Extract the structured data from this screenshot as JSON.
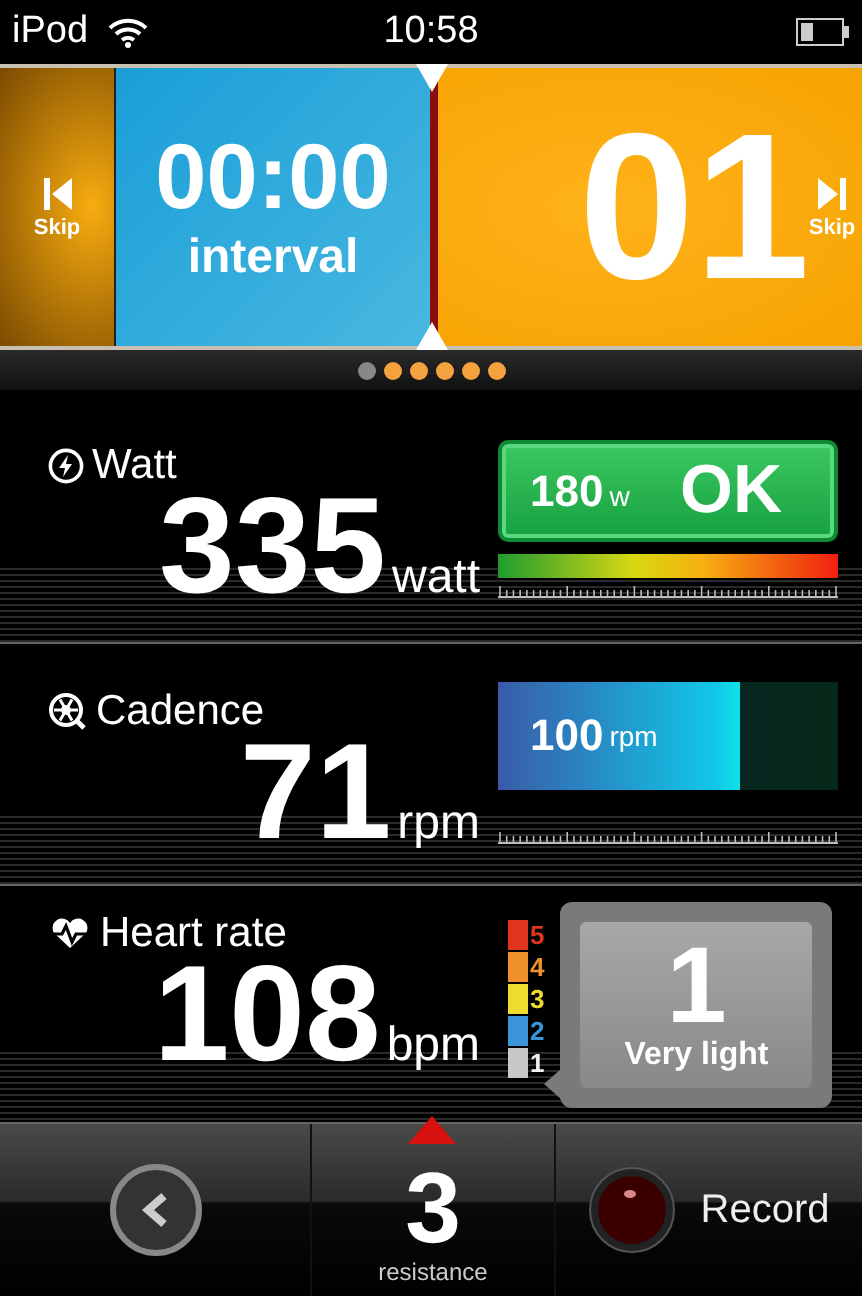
{
  "status_bar": {
    "carrier": "iPod",
    "time": "10:58"
  },
  "interval": {
    "prev_label": "Skip",
    "time": "00:00",
    "caption": "interval",
    "next_value": "01",
    "next_label": "Skip"
  },
  "page_dots": [
    {
      "selected": true
    },
    {
      "selected": false
    },
    {
      "selected": false
    },
    {
      "selected": false
    },
    {
      "selected": false
    },
    {
      "selected": false
    }
  ],
  "metrics": [
    {
      "kind": "target",
      "label": "Watt",
      "value": "335",
      "unit": "watt",
      "target": "180",
      "target_unit": "w",
      "status": "OK"
    },
    {
      "kind": "bar",
      "label": "Cadence",
      "value": "71",
      "unit": "rpm",
      "target": "100",
      "target_unit": "rpm",
      "level": 0.71
    },
    {
      "kind": "zones",
      "label": "Heart rate",
      "value": "108",
      "unit": "bpm",
      "zone_number": "1",
      "zone_name": "Very light",
      "zones": [
        {
          "label": "5",
          "color": "#e0341c",
          "selected": false
        },
        {
          "label": "4",
          "color": "#f0902a",
          "selected": false
        },
        {
          "label": "3",
          "color": "#eedd30",
          "selected": false
        },
        {
          "label": "2",
          "color": "#3a96d8",
          "selected": false
        },
        {
          "label": "1",
          "color": "#c8c8c8",
          "selected": true
        }
      ]
    }
  ],
  "toolbar": {
    "resistance": "3",
    "resistance_label": "resistance",
    "record_label": "Record"
  }
}
